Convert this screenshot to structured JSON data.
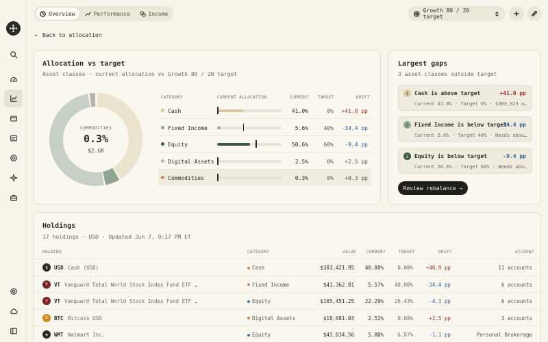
{
  "colors": {
    "cash": "#d8c8a2",
    "fixed_income": "#8fa592",
    "equity": "#3d5a48",
    "digital_assets": "#b6b4a8",
    "commodities": "#c58c5e",
    "donut_cash": "#eae3cd",
    "donut_equity": "#c6d0c4",
    "positive": "#a0302a",
    "negative": "#2e5f95"
  },
  "nav": {
    "tabs": [
      {
        "label": "Overview",
        "icon": "clock-icon"
      },
      {
        "label": "Performance",
        "icon": "trend-icon"
      },
      {
        "label": "Income",
        "icon": "coins-icon"
      }
    ],
    "target_selector": "Growth 80 / 20 target",
    "back_label": "Back to allocation"
  },
  "allocation": {
    "title": "Allocation vs target",
    "subtitle": "Asset classes · current allocation vs Growth 80 / 20 target",
    "donut": {
      "label": "COMMODITIES",
      "value": "0.3%",
      "amount": "$2.6K"
    },
    "headers": {
      "category": "CATEGORY",
      "current_allocation": "CURRENT ALLOCATION",
      "current": "CURRENT",
      "target": "TARGET",
      "drift": "DRIFT"
    },
    "rows": [
      {
        "name": "Cash",
        "current": "41.0%",
        "target": "0%",
        "drift": "+41.0 pp",
        "current_pct": 41.0,
        "target_pct": 0,
        "color": "#d8c8a2",
        "dir": "pos"
      },
      {
        "name": "Fixed Income",
        "current": "5.6%",
        "target": "40%",
        "drift": "-34.4 pp",
        "current_pct": 5.6,
        "target_pct": 40,
        "color": "#8fa592",
        "dir": "neg"
      },
      {
        "name": "Equity",
        "current": "50.6%",
        "target": "60%",
        "drift": "-9.4 pp",
        "current_pct": 50.6,
        "target_pct": 60,
        "color": "#3d5a48",
        "dir": "neg"
      },
      {
        "name": "Digital Assets",
        "current": "2.5%",
        "target": "0%",
        "drift": "+2.5 pp",
        "current_pct": 2.5,
        "target_pct": 0,
        "color": "#b6b4a8",
        "dir": "neutral"
      },
      {
        "name": "Commodities",
        "current": "0.3%",
        "target": "0%",
        "drift": "+0.3 pp",
        "current_pct": 0.3,
        "target_pct": 0,
        "color": "#c58c5e",
        "dir": "neutral"
      }
    ]
  },
  "gaps": {
    "title": "Largest gaps",
    "subtitle": "3 asset classes outside target",
    "items": [
      {
        "num": "1",
        "title": "Cash is above target",
        "drift": "+41.0 pp",
        "detail": "Current 41.0% · Target 0% · $303,923 abo...",
        "dir": "pos",
        "color": "#d8c8a2"
      },
      {
        "num": "2",
        "title": "Fixed Income is below target",
        "drift": "-34.4 pp",
        "detail": "Current 5.6% · Target 40% · Needs about ...",
        "dir": "neg",
        "color": "#8fa592"
      },
      {
        "num": "3",
        "title": "Equity is below target",
        "drift": "-9.4 pp",
        "detail": "Current 50.6% · Target 60% · Needs about ...",
        "dir": "neg",
        "color": "#3d5a48"
      }
    ],
    "review_label": "Review rebalance →"
  },
  "holdings": {
    "title": "Holdings",
    "subtitle": "17 holdings · USD · Updated Jun 7, 9:17 PM ET",
    "headers": {
      "holding": "HOLDING",
      "category": "CATEGORY",
      "value": "VALUE",
      "current": "CURRENT",
      "target": "TARGET",
      "drift": "DRIFT",
      "account": "ACCOUNT"
    },
    "rows": [
      {
        "icon": "$",
        "icon_color": "#2b2b26",
        "symbol": "USD",
        "name": "Cash (USD)",
        "category": "Cash",
        "cat_color": "#c58c5e",
        "value": "$303,421.95",
        "current": "40.88%",
        "target": "0.00%",
        "drift": "+40.9 pp",
        "dir": "pos",
        "account": "11 accounts"
      },
      {
        "icon": "V",
        "icon_color": "#7a2424",
        "symbol": "VT",
        "name": "Vanguard Total World Stock Index Fund ETF Sh...",
        "category": "Fixed Income",
        "cat_color": "#c58c5e",
        "value": "$41,362.81",
        "current": "5.57%",
        "target": "40.00%",
        "drift": "-34.4 pp",
        "dir": "neg",
        "account": "6 accounts"
      },
      {
        "icon": "V",
        "icon_color": "#7a2424",
        "symbol": "VT",
        "name": "Vanguard Total World Stock Index Fund ETF Sh...",
        "category": "Equity",
        "cat_color": "#4a76a8",
        "value": "$165,451.25",
        "current": "22.29%",
        "target": "26.43%",
        "drift": "-4.1 pp",
        "dir": "neg",
        "account": "6 accounts"
      },
      {
        "icon": "B",
        "icon_color": "#d4891f",
        "symbol": "BTC",
        "name": "Bitcoin USD",
        "category": "Digital Assets",
        "cat_color": "#c58c5e",
        "value": "$18,681.03",
        "current": "2.52%",
        "target": "0.00%",
        "drift": "+2.5 pp",
        "dir": "pos",
        "account": "3 accounts"
      },
      {
        "icon": "✱",
        "icon_color": "#2b2b26",
        "symbol": "WMT",
        "name": "Walmart Inc.",
        "category": "Equity",
        "cat_color": "#4a76a8",
        "value": "$43,034.56",
        "current": "5.80%",
        "target": "6.87%",
        "drift": "-1.1 pp",
        "dir": "neg",
        "account": "Personal Brokerage"
      }
    ]
  }
}
